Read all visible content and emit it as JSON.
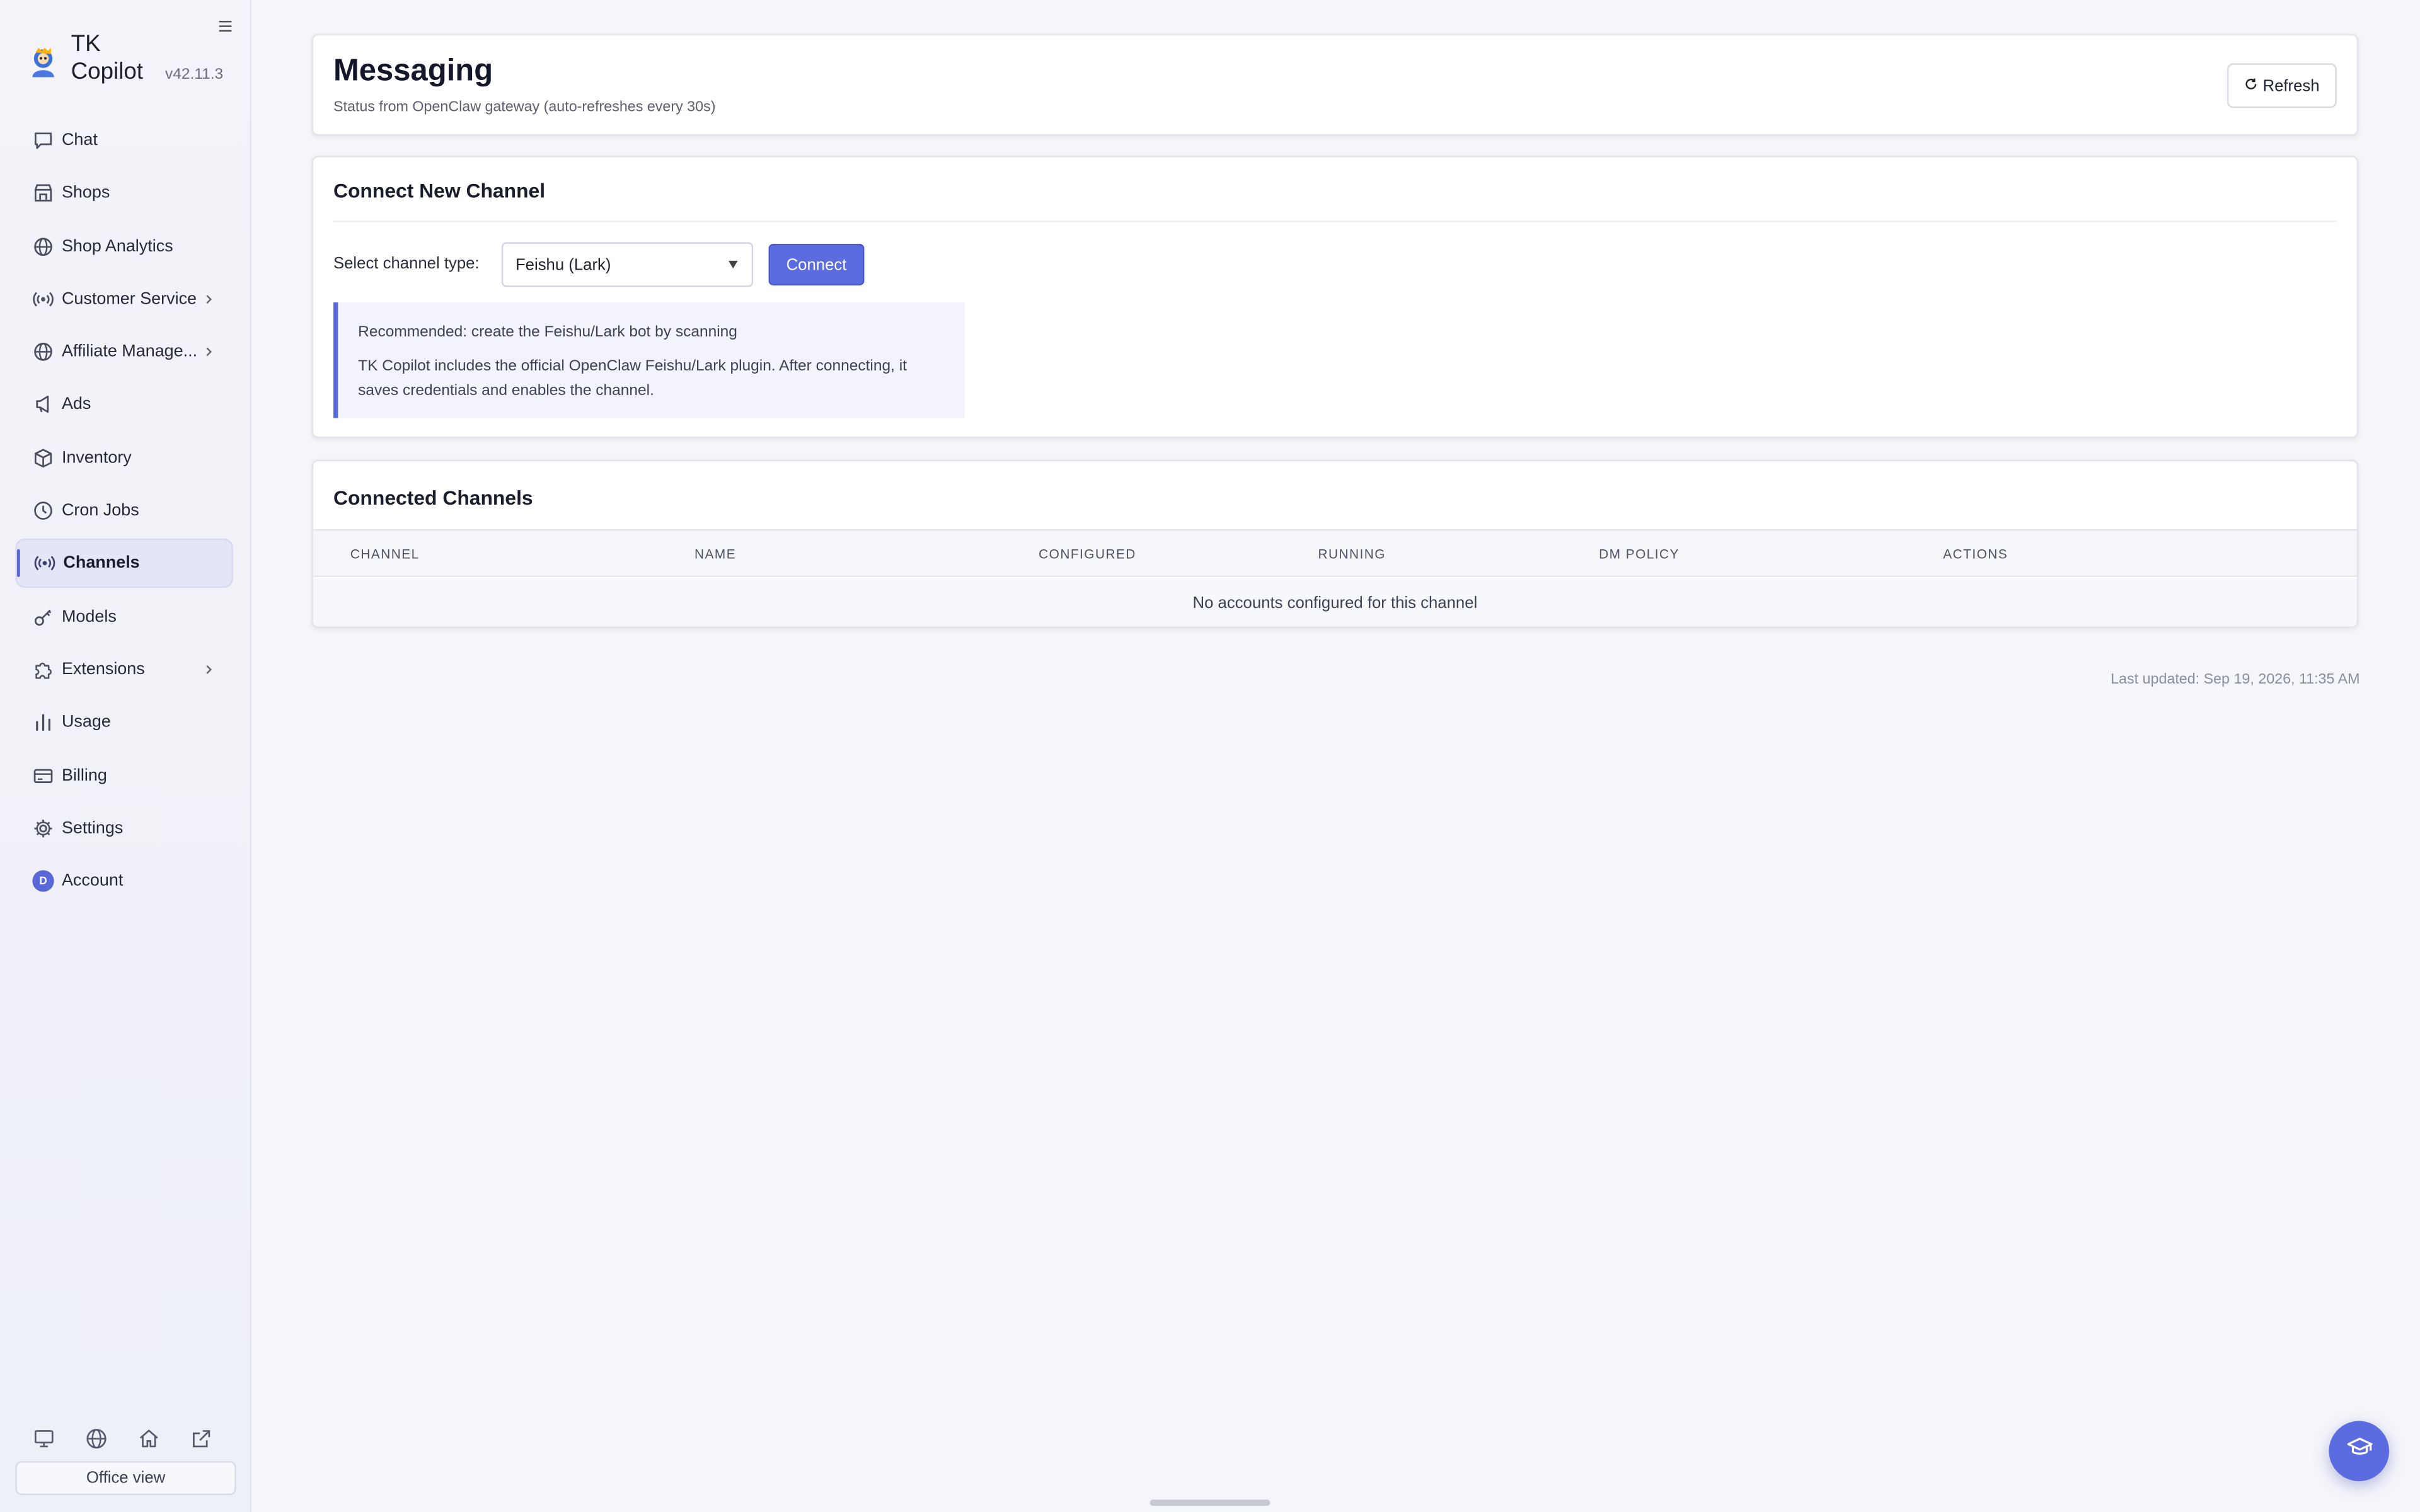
{
  "app": {
    "name": "TK Copilot",
    "version": "v42.11.3"
  },
  "sidebar": {
    "items": [
      {
        "label": "Chat",
        "icon": "chat-bubble-icon"
      },
      {
        "label": "Shops",
        "icon": "store-icon"
      },
      {
        "label": "Shop Analytics",
        "icon": "globe-icon"
      },
      {
        "label": "Customer Service",
        "icon": "broadcast-icon",
        "has_submenu": true
      },
      {
        "label": "Affiliate Manage...",
        "icon": "globe-icon",
        "has_submenu": true
      },
      {
        "label": "Ads",
        "icon": "megaphone-icon"
      },
      {
        "label": "Inventory",
        "icon": "box-icon"
      },
      {
        "label": "Cron Jobs",
        "icon": "clock-icon"
      },
      {
        "label": "Channels",
        "icon": "broadcast-icon",
        "active": true
      },
      {
        "label": "Models",
        "icon": "key-icon"
      },
      {
        "label": "Extensions",
        "icon": "puzzle-icon",
        "has_submenu": true
      },
      {
        "label": "Usage",
        "icon": "bar-chart-icon"
      },
      {
        "label": "Billing",
        "icon": "credit-card-icon"
      },
      {
        "label": "Settings",
        "icon": "gear-icon"
      },
      {
        "label": "Account",
        "icon": "avatar",
        "avatar_initial": "D"
      }
    ],
    "bottom_icons": [
      "monitor-icon",
      "globe-icon",
      "home-icon",
      "external-link-icon"
    ],
    "office_view_label": "Office view"
  },
  "header": {
    "title": "Messaging",
    "subtitle": "Status from OpenClaw gateway (auto-refreshes every 30s)",
    "refresh_label": "Refresh"
  },
  "connect": {
    "title": "Connect New Channel",
    "select_label": "Select channel type:",
    "selected_channel": "Feishu (Lark)",
    "connect_label": "Connect",
    "notice_line1": "Recommended: create the Feishu/Lark bot by scanning",
    "notice_line2": "TK Copilot includes the official OpenClaw Feishu/Lark plugin. After connecting, it saves credentials and enables the channel."
  },
  "channels": {
    "title": "Connected Channels",
    "columns": [
      "CHANNEL",
      "NAME",
      "CONFIGURED",
      "RUNNING",
      "DM POLICY",
      "ACTIONS"
    ],
    "empty_text": "No accounts configured for this channel"
  },
  "footer": {
    "last_updated": "Last updated: Sep 19, 2026, 11:35 AM"
  },
  "colors": {
    "accent": "#5b6be0",
    "sidebar_active_bg": "#e4e6f7",
    "page_bg": "#f5f6fa"
  }
}
